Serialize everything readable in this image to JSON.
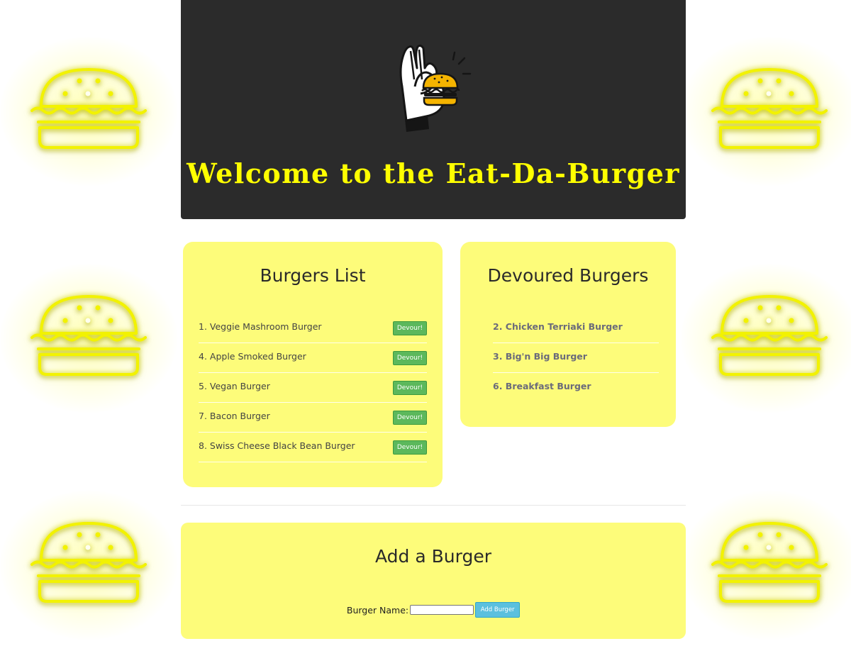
{
  "header": {
    "title": "Welcome to the Eat-Da-Burger",
    "logo_icon": "ok-hand-burger-icon",
    "title_color": "#ffff00",
    "background_color": "#2b2b2b"
  },
  "burgers_list": {
    "heading": "Burgers List",
    "button_label": "Devour!",
    "items": [
      {
        "text": "1. Veggie Mashroom Burger"
      },
      {
        "text": "4. Apple Smoked Burger"
      },
      {
        "text": "5. Vegan Burger"
      },
      {
        "text": "7. Bacon Burger"
      },
      {
        "text": "8. Swiss Cheese Black Bean Burger"
      }
    ]
  },
  "devoured": {
    "heading": "Devoured Burgers",
    "items": [
      {
        "text": "2. Chicken Terriaki Burger"
      },
      {
        "text": "3. Big'n Big Burger"
      },
      {
        "text": "6. Breakfast Burger"
      }
    ]
  },
  "add_burger": {
    "heading": "Add a Burger",
    "field_label": "Burger Name:",
    "field_value": "",
    "button_label": "Add Burger"
  },
  "background": {
    "icon": "neon-burger-icon",
    "neon_color": "#ffff00"
  },
  "colors": {
    "card": "#fdfc7a",
    "devour_button": "#5cb85c",
    "add_button": "#5bc0de"
  }
}
